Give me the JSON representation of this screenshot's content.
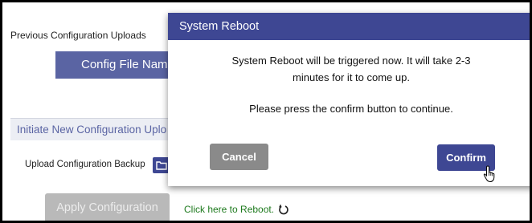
{
  "background": {
    "previous_uploads_label": "Previous Configuration Uploads",
    "config_file_name_header": "Config File Name",
    "initiate_section_title": "Initiate New Configuration Uplo",
    "upload_backup_label": "Upload Configuration Backup",
    "apply_button_label": "Apply Configuration",
    "reboot_link_text": "Click here to Reboot.",
    "icons": [
      "folder-upload-icon",
      "reboot-icon"
    ]
  },
  "modal": {
    "title": "System Reboot",
    "message_line1": "System Reboot will be triggered now. It will take 2-3",
    "message_line2": "minutes for it to come up.",
    "message_line3": "Please press the confirm button to continue.",
    "cancel_label": "Cancel",
    "confirm_label": "Confirm"
  },
  "colors": {
    "primary": "#3e4793",
    "header_band": "#5a64a3",
    "cancel": "#8a8a8a",
    "apply_disabled": "#b9b9b9",
    "link_green": "#1e7a1e"
  }
}
